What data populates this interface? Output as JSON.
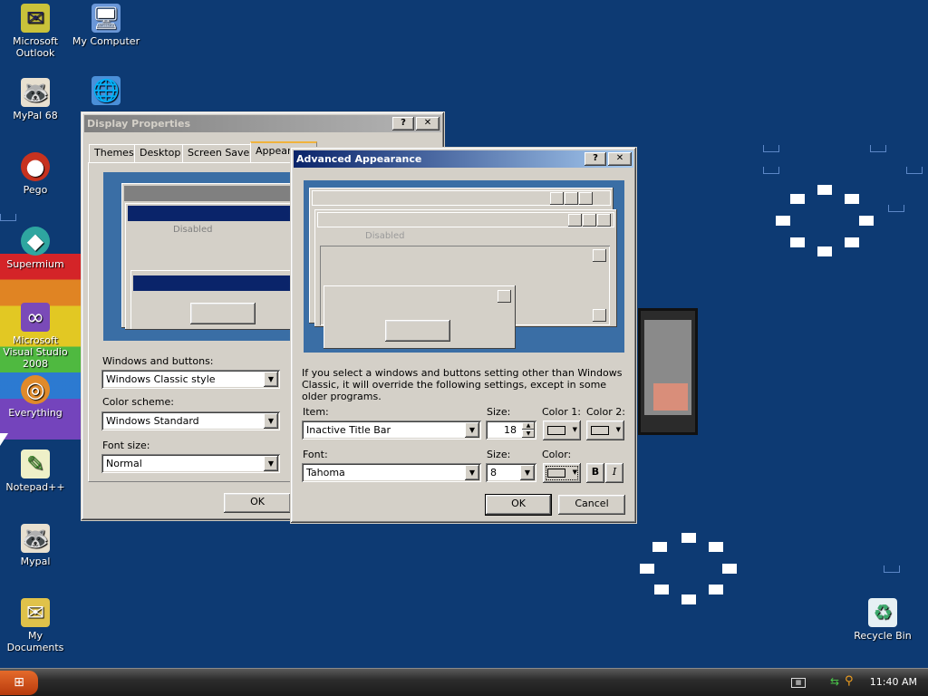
{
  "desktop": {
    "icons": [
      {
        "label": "Microsoft Outlook",
        "glyph": "✉",
        "color": "#c9c23a"
      },
      {
        "label": "My Computer",
        "glyph": "🖥",
        "color": "#6a97d8"
      },
      {
        "label": "MyPal 68",
        "glyph": "🦝",
        "color": "#8a6a4a"
      },
      {
        "label": "",
        "glyph": "🌐",
        "color": "#4a8fd8"
      },
      {
        "label": "Pego",
        "glyph": "●",
        "color": "#c7321f"
      },
      {
        "label": "Supermium",
        "glyph": "◆",
        "color": "#2ea6a0"
      },
      {
        "label": "Microsoft Visual Studio 2008",
        "glyph": "∞",
        "color": "#7a4ab8"
      },
      {
        "label": "Everything",
        "glyph": "◎",
        "color": "#e08a2a"
      },
      {
        "label": "Notepad++",
        "glyph": "✎",
        "color": "#7ab83a"
      },
      {
        "label": "Mypal",
        "glyph": "🦝",
        "color": "#8a6a4a"
      },
      {
        "label": "My Documents",
        "glyph": "✉",
        "color": "#e0c24a"
      },
      {
        "label": "Recycle Bin",
        "glyph": "♻",
        "color": "#3aa86a"
      }
    ]
  },
  "display_properties": {
    "title": "Display Properties",
    "tabs": [
      "Themes",
      "Desktop",
      "Screen Saver",
      "Appearance"
    ],
    "preview_disabled": "Disabled",
    "windows_buttons_label": "Windows and buttons:",
    "windows_buttons_value": "Windows Classic style",
    "color_scheme_label": "Color scheme:",
    "color_scheme_value": "Windows Standard",
    "font_size_label": "Font size:",
    "font_size_value": "Normal",
    "ok_label": "OK"
  },
  "advanced_appearance": {
    "title": "Advanced Appearance",
    "preview_disabled": "Disabled",
    "info_text": "If you select a windows and buttons setting other than Windows Classic, it will override the following settings, except in some older programs.",
    "item_label": "Item:",
    "item_value": "Inactive Title Bar",
    "size_label": "Size:",
    "size_value": "18",
    "color1_label": "Color 1:",
    "color2_label": "Color 2:",
    "font_label": "Font:",
    "font_value": "Tahoma",
    "font_size_label": "Size:",
    "font_size_value": "8",
    "font_color_label": "Color:",
    "bold_label": "B",
    "italic_label": "I",
    "ok_label": "OK",
    "cancel_label": "Cancel"
  },
  "taskbar": {
    "clock": "11:40 AM"
  },
  "colors": {
    "desktop_bg": "#0d3a73",
    "active_title": "#0a246a",
    "inactive_title": "#808080"
  }
}
